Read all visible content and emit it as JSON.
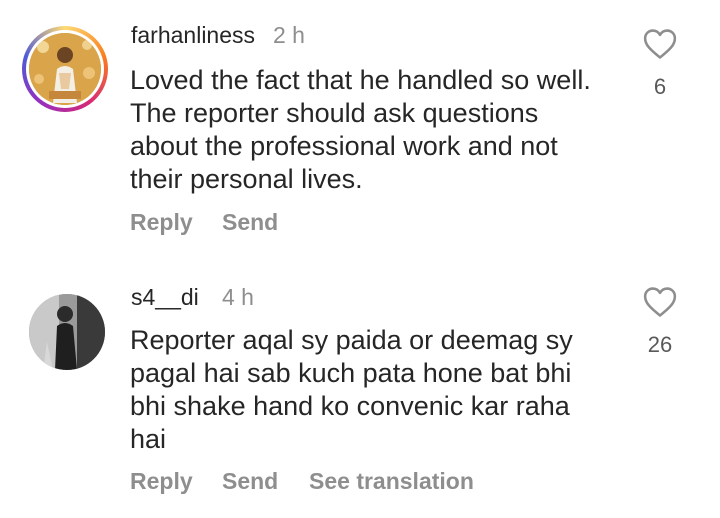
{
  "comments": [
    {
      "username": "farhanliness",
      "time": "2 h",
      "text": [
        "Loved the fact that he handled so well.",
        "The reporter should ask questions",
        "about the professional work and not",
        "their personal lives."
      ],
      "actions": [
        "Reply",
        "Send"
      ],
      "likes": "6"
    },
    {
      "username": "s4__di",
      "time": "4 h",
      "text": [
        "Reporter aqal sy paida or deemag sy",
        "pagal hai sab kuch pata hone bat bhi",
        "bhi shake hand ko convenic kar raha",
        "hai"
      ],
      "actions": [
        "Reply",
        "Send",
        "See translation"
      ],
      "likes": "26"
    }
  ],
  "colors": {
    "text": "#262626",
    "secondary": "#8e8e8e",
    "story_ring": [
      "#feda75",
      "#fa7e1e",
      "#d62976",
      "#962fbf",
      "#4f5bd5"
    ]
  },
  "icons": {
    "like": "heart-outline-icon"
  }
}
